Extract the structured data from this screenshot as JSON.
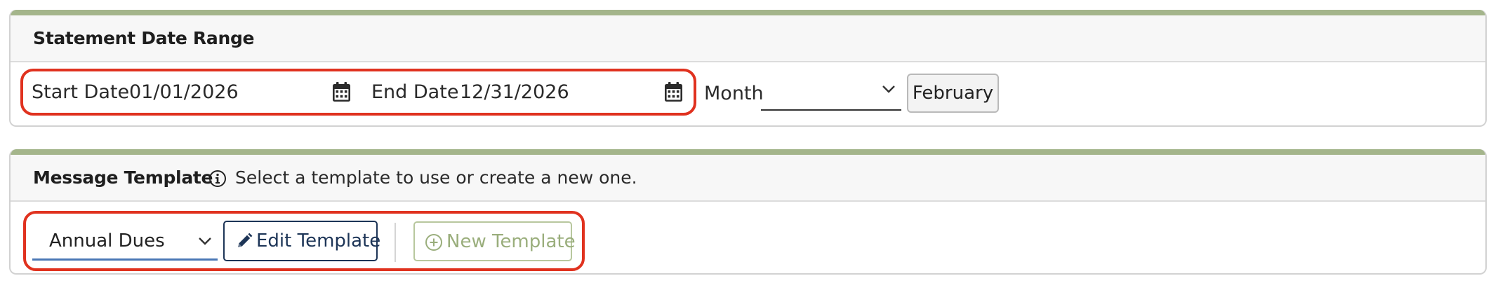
{
  "date_range": {
    "title": "Statement Date Range",
    "start_label": "Start Date",
    "start_value": "01/01/2026",
    "end_label": "End Date",
    "end_value": "12/31/2026",
    "month_label": "Month",
    "month_value": "",
    "month_button": "February"
  },
  "message_template": {
    "title": "Message Template",
    "info": "Select a template to use or create a new one.",
    "selected": "Annual Dues",
    "edit_button": "Edit Template",
    "new_button": "New Template"
  },
  "colors": {
    "accent": "#a4b58b",
    "highlight": "#e0321f",
    "edit_border": "#1d3557",
    "new_disabled": "#9aae7c"
  }
}
